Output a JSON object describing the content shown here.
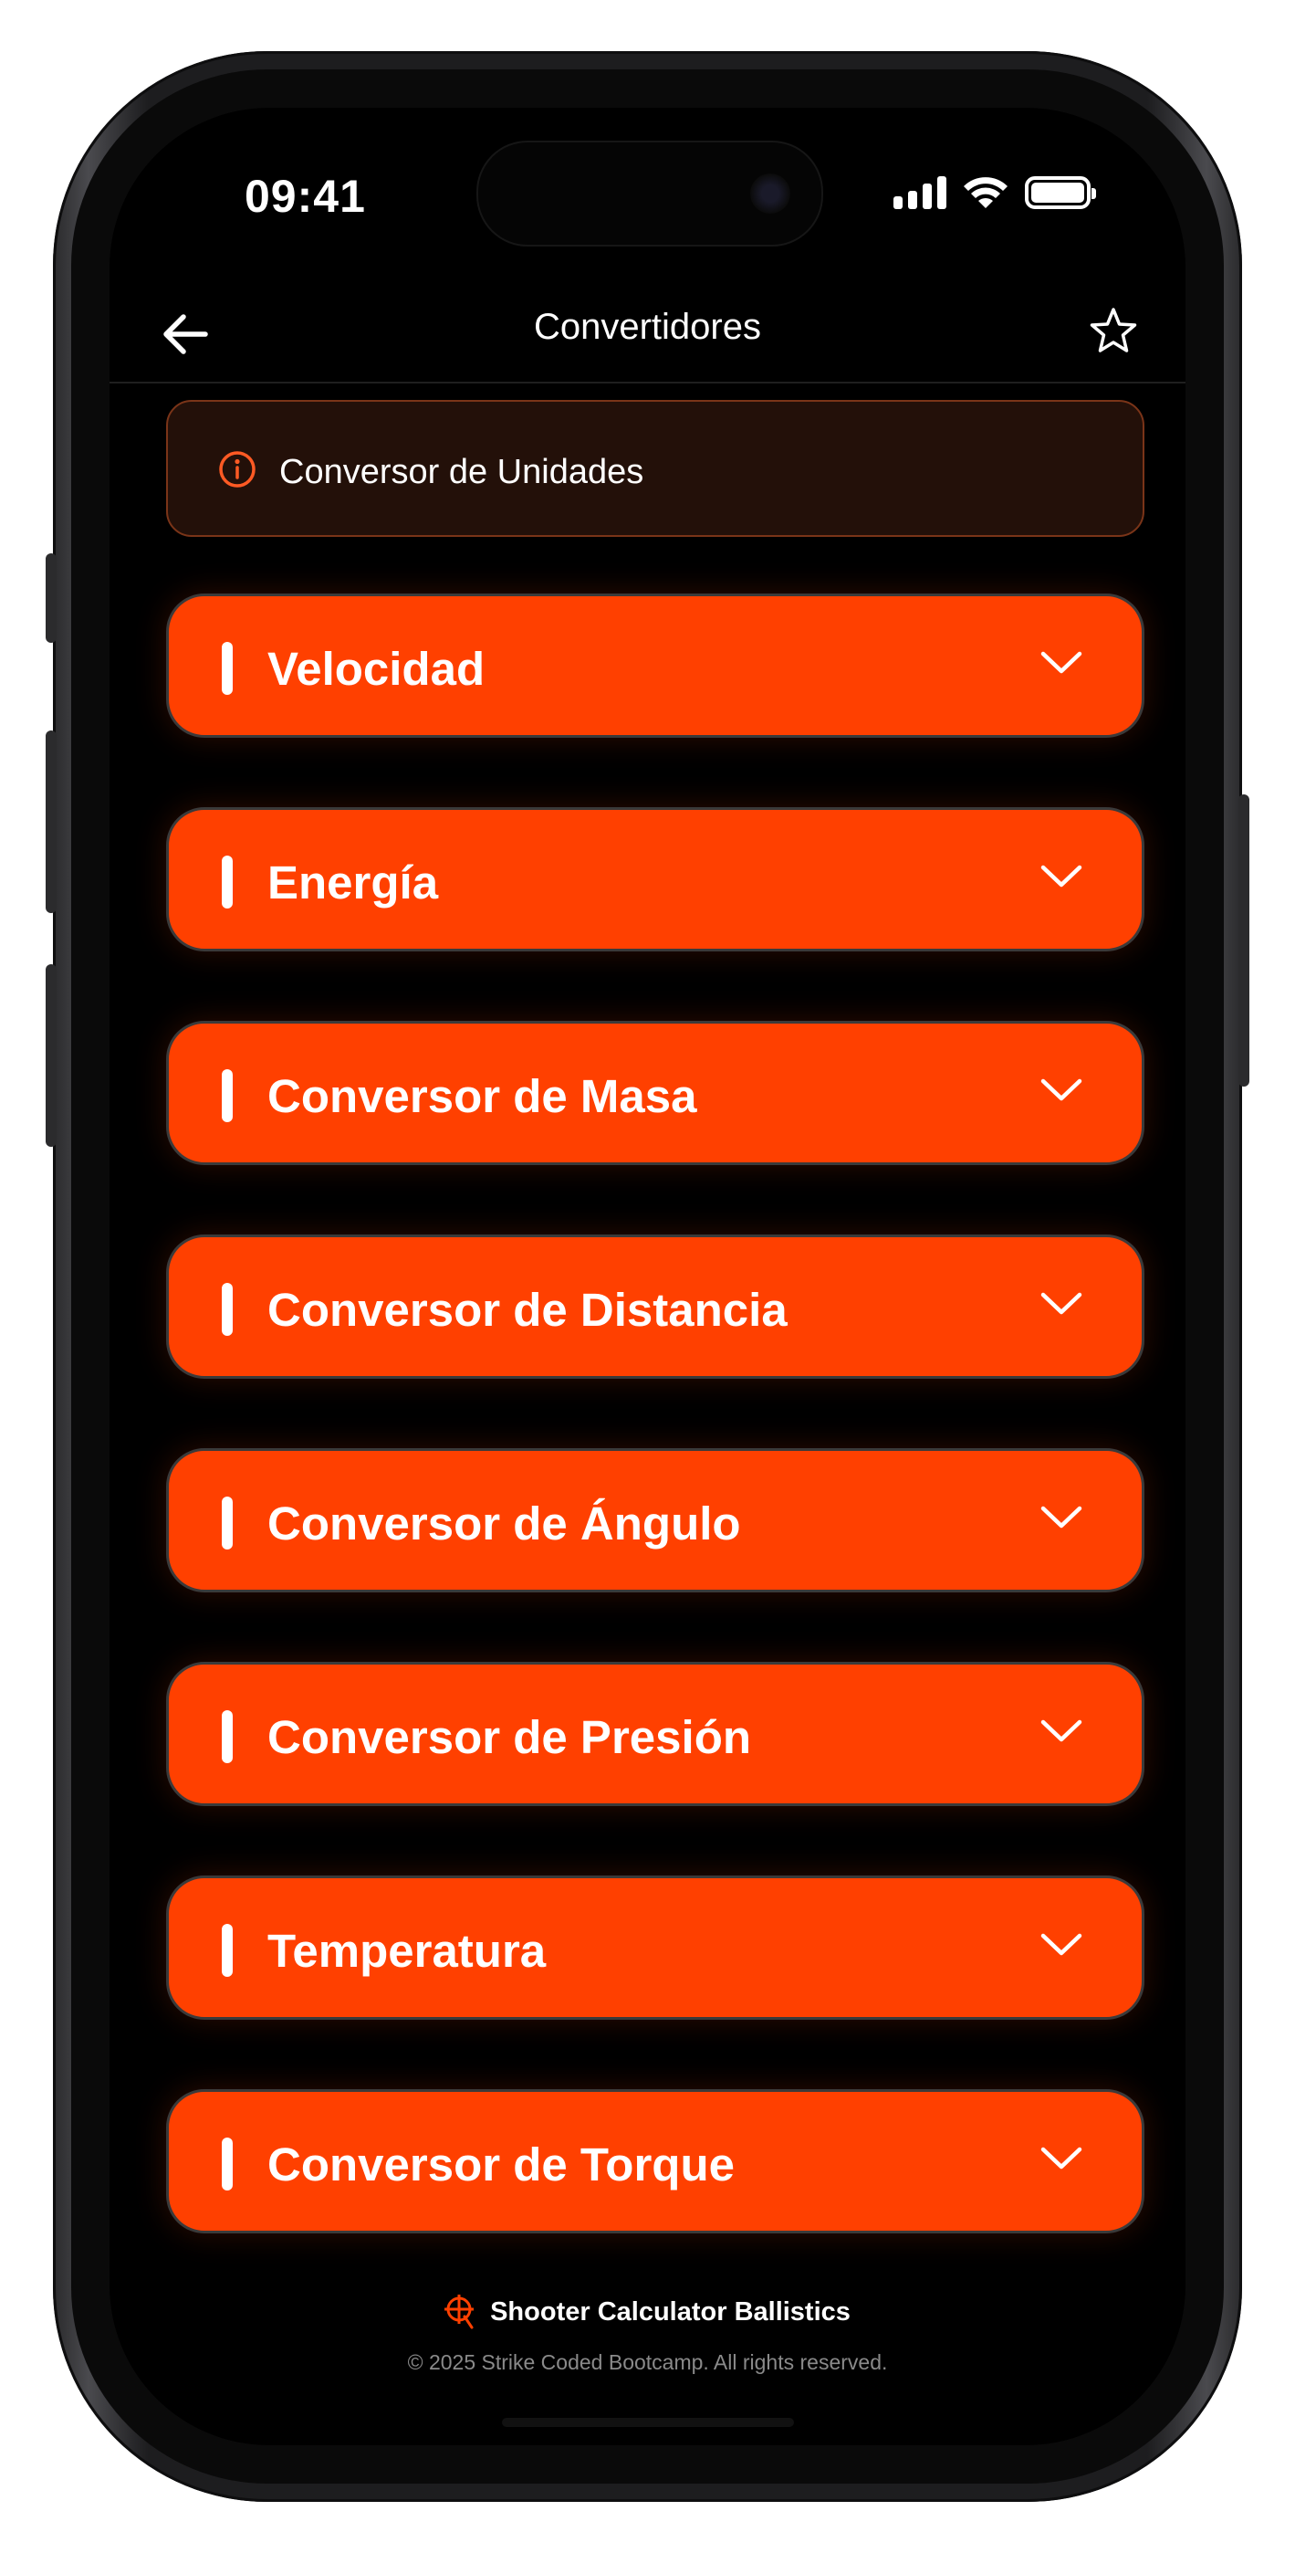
{
  "status_bar": {
    "time": "09:41"
  },
  "nav": {
    "title": "Convertidores",
    "back_icon": "arrow-left-icon",
    "favorite_icon": "star-icon"
  },
  "info_banner": {
    "icon": "info-circle-icon",
    "text": "Conversor de Unidades"
  },
  "converters": [
    {
      "label": "Velocidad"
    },
    {
      "label": "Energía"
    },
    {
      "label": "Conversor de Masa"
    },
    {
      "label": "Conversor de Distancia"
    },
    {
      "label": "Conversor de Ángulo"
    },
    {
      "label": "Conversor de Presión"
    },
    {
      "label": "Temperatura"
    },
    {
      "label": "Conversor de Torque"
    }
  ],
  "footer": {
    "brand": "Shooter Calculator Ballistics",
    "copyright": "© 2025 Strike Coded Bootcamp. All rights reserved.",
    "logo_icon": "crosshair-logo-icon"
  },
  "colors": {
    "accent": "#ff4000",
    "background": "#000000",
    "banner_bg": "#231009",
    "banner_border": "#7a3418"
  }
}
